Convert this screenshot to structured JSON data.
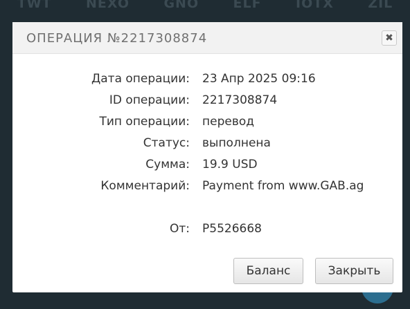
{
  "background": {
    "tickers": [
      "TWT",
      "NEXO",
      "GNO",
      "ELF",
      "IOTX",
      "ZIL"
    ]
  },
  "modal": {
    "title": "ОПЕРАЦИЯ №2217308874",
    "close_icon": "close-icon",
    "fields": [
      {
        "label": "Дата операции:",
        "value": "23 Апр 2025 09:16"
      },
      {
        "label": "ID операции:",
        "value": "2217308874"
      },
      {
        "label": "Тип операции:",
        "value": "перевод"
      },
      {
        "label": "Статус:",
        "value": "выполнена"
      },
      {
        "label": "Сумма:",
        "value": "19.9 USD"
      },
      {
        "label": "Комментарий:",
        "value": "Payment from www.GAB.ag"
      },
      {
        "label": "От:",
        "value": "P5526668"
      }
    ],
    "buttons": {
      "balance_label": "Баланс",
      "close_label": "Закрыть"
    }
  }
}
